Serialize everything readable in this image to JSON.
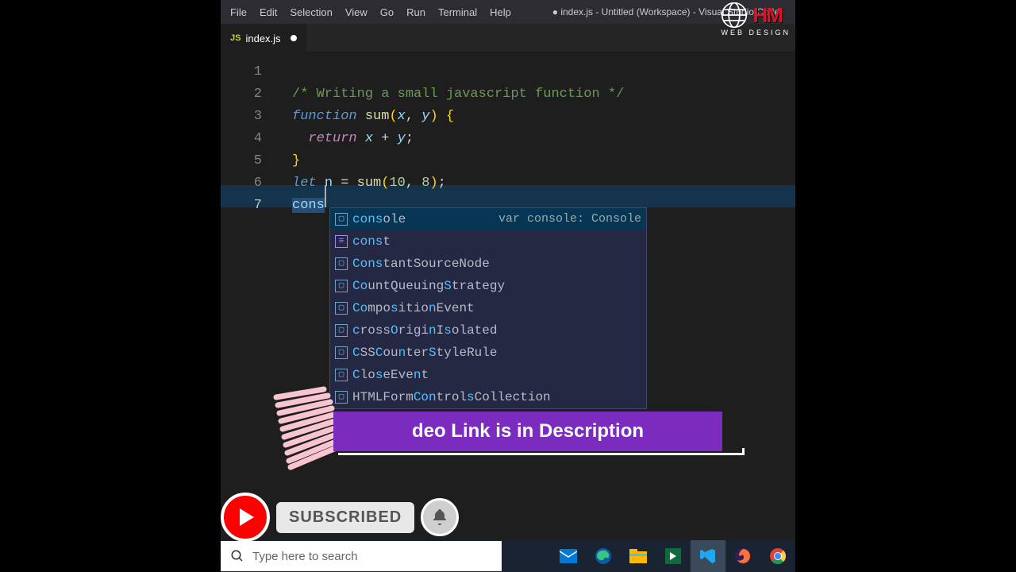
{
  "window_title": "● index.js - Untitled (Workspace) - Visual Studio Code",
  "menu": [
    "File",
    "Edit",
    "Selection",
    "View",
    "Go",
    "Run",
    "Terminal",
    "Help"
  ],
  "tab": {
    "icon": "JS",
    "name": "index.js"
  },
  "lines": [
    "1",
    "2",
    "3",
    "4",
    "5",
    "6",
    "7"
  ],
  "code": {
    "comment": "/* Writing a small javascript function */",
    "fn_kw": "function",
    "fn_name": "sum",
    "p1": "x",
    "p2": "y",
    "ret_kw": "return",
    "let_kw": "let",
    "var_n": "n",
    "num1": "10",
    "num2": "8",
    "typed": "cons"
  },
  "suggestions": [
    {
      "kind": "var",
      "pre": "cons",
      "rest": "ole",
      "detail": "var console: Console",
      "selected": true
    },
    {
      "kind": "kw",
      "pre": "cons",
      "rest": "t"
    },
    {
      "kind": "var",
      "pre": "Cons",
      "rest": "tantSourceNode"
    },
    {
      "kind": "var",
      "pre": "Co",
      "mid": "u",
      "after1": "ntQueuing",
      "hl2": "S",
      "after2": "trategy"
    },
    {
      "kind": "var",
      "pre": "Co",
      "mid": "mpo",
      "hl2": "s",
      "after1": "itio",
      "hl3": "n",
      "after2": "Event"
    },
    {
      "kind": "var",
      "pre": "c",
      "mid": "ross",
      "hl2": "O",
      "after1": "rigi",
      "hl3": "n",
      "after2": "I",
      "hl4": "s",
      "after3": "olated"
    },
    {
      "kind": "var",
      "pre": "C",
      "mid": "SS",
      "hl2": "C",
      "after1": "ou",
      "hl3": "n",
      "after2": "ter",
      "hl4": "S",
      "after3": "tyleRule"
    },
    {
      "kind": "var",
      "pre": "C",
      "mid": "lo",
      "hl2": "s",
      "after1": "eEve",
      "hl3": "n",
      "after2": "t"
    },
    {
      "kind": "var",
      "mid2": "HTMLForm",
      "hl2": "Con",
      "after1": "trol",
      "hl3": "s",
      "after2": "Collection"
    }
  ],
  "banner_text": "deo Link is in Description",
  "subscribed_label": "SUBSCRIBED",
  "search_placeholder": "Type here to search",
  "logo": {
    "brand": "HM",
    "sub": "WEB DESIGN"
  }
}
